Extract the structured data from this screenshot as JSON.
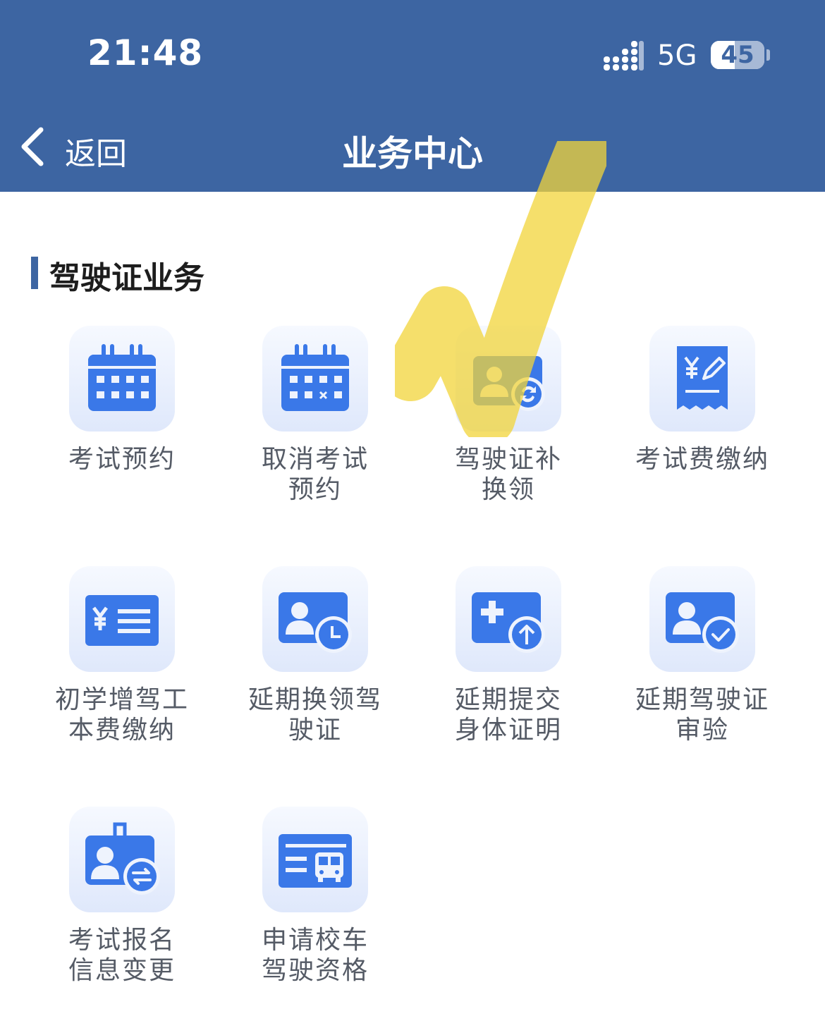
{
  "status_bar": {
    "time": "21:48",
    "network": "5G",
    "battery": "45",
    "battery_level": 0.45
  },
  "nav": {
    "back_label": "返回",
    "title": "业务中心"
  },
  "section": {
    "title": "驾驶证业务"
  },
  "services": [
    {
      "label": "考试预约",
      "icon": "calendar-icon"
    },
    {
      "label": "取消考试预约",
      "icon": "calendar-cancel-icon"
    },
    {
      "label": "驾驶证补换领",
      "icon": "license-exchange-icon"
    },
    {
      "label": "考试费缴纳",
      "icon": "fee-receipt-icon"
    },
    {
      "label": "初学增驾工本费缴纳",
      "icon": "payment-card-icon"
    },
    {
      "label": "延期换领驾驶证",
      "icon": "license-clock-icon"
    },
    {
      "label": "延期提交身体证明",
      "icon": "medical-upload-icon"
    },
    {
      "label": "延期驾驶证审验",
      "icon": "license-check-icon"
    },
    {
      "label": "考试报名信息变更",
      "icon": "badge-swap-icon"
    },
    {
      "label": "申请校车驾驶资格",
      "icon": "school-bus-card-icon"
    }
  ],
  "colors": {
    "header": "#3d65a2",
    "icon_blue": "#3a78e8",
    "highlight": "#f2d43a"
  }
}
